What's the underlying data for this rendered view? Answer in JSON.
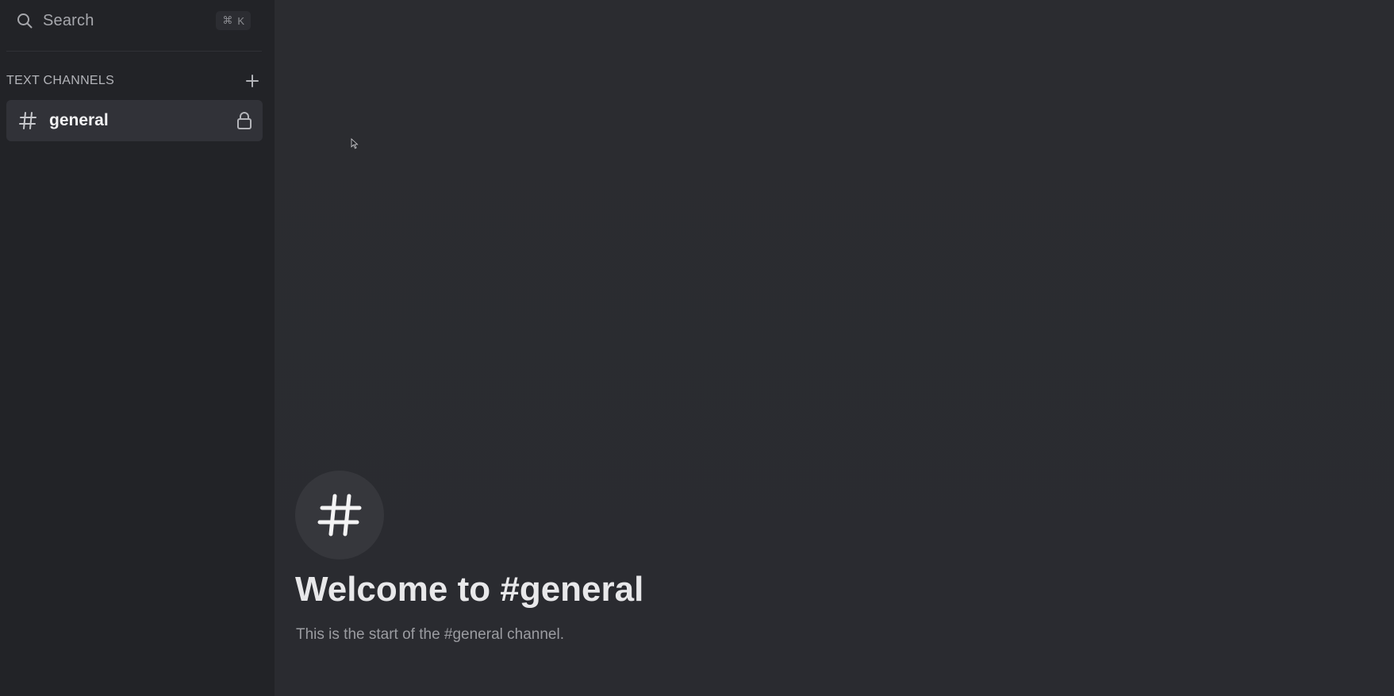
{
  "search": {
    "label": "Search",
    "shortcut_symbol": "⌘",
    "shortcut_key": "K",
    "icon": "search-icon"
  },
  "sidebar": {
    "section_title": "TEXT CHANNELS",
    "add_icon": "plus-icon",
    "channels": [
      {
        "name": "general",
        "icon": "hash-icon",
        "locked_icon": "lock-icon",
        "selected": true
      }
    ]
  },
  "main": {
    "welcome_icon": "hash-icon",
    "welcome_title": "Welcome to #general",
    "welcome_subtitle": "This is the start of the #general channel."
  },
  "colors": {
    "sidebar_bg": "#222327",
    "main_bg": "#2a2b30",
    "selected_channel_bg": "#313238",
    "text_primary": "#e8e8ea",
    "text_muted": "#9b9ca1"
  }
}
